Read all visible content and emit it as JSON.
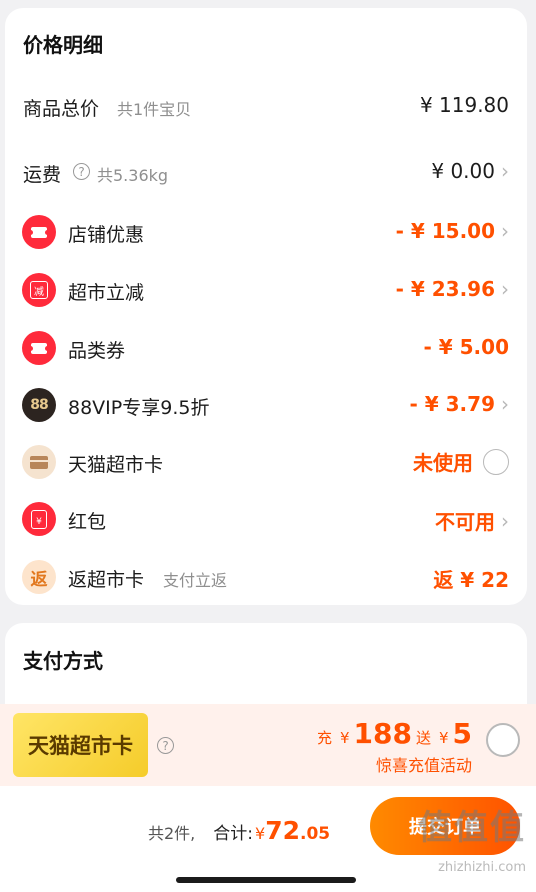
{
  "price_detail": {
    "title": "价格明细",
    "rows": [
      {
        "label": "商品总价",
        "sub": "共1件宝贝",
        "value": "¥ 119.80"
      },
      {
        "label": "运费",
        "sub": "共5.36kg",
        "value": "¥ 0.00",
        "icon": "help-icon"
      },
      {
        "label": "店铺优惠",
        "value": "- ¥ 15.00",
        "icon": "coupon-ticket-icon"
      },
      {
        "label": "超市立减",
        "value": "- ¥ 23.96",
        "icon": "instant-discount-icon",
        "icon_text": "减"
      },
      {
        "label": "品类券",
        "value": "- ¥ 5.00",
        "icon": "coupon-ticket-icon"
      },
      {
        "label": "88VIP专享9.5折",
        "value": "- ¥ 3.79",
        "icon": "vip88-icon",
        "icon_text": "88"
      },
      {
        "label": "天猫超市卡",
        "value": "未使用",
        "icon": "gift-card-icon"
      },
      {
        "label": "红包",
        "value": "不可用",
        "icon": "red-packet-icon",
        "icon_text": "¥"
      },
      {
        "label": "返超市卡",
        "sub": "支付立返",
        "value": "返 ¥ 22",
        "icon": "cashback-icon",
        "icon_text": "返"
      }
    ]
  },
  "payment": {
    "title": "支付方式"
  },
  "promo": {
    "badge": "天猫超市卡",
    "charge_label": "充",
    "charge_currency": "¥",
    "charge_amount": "188",
    "gift_label": "送",
    "gift_currency": "¥",
    "gift_amount": "5",
    "subtitle": "惊喜充值活动"
  },
  "bottom": {
    "count": "共2件,",
    "total_label": "合计:",
    "currency": "¥",
    "total_int": "72",
    "total_dec": ".05",
    "submit": "提交订单"
  },
  "watermark": {
    "text": "值值值",
    "url": "zhizhizhi.com"
  },
  "colors": {
    "accent": "#ff5000",
    "icon_red": "#ff2a3b",
    "promo_bg": "#fff1ec",
    "badge_yellow": "#f5cc2a"
  }
}
